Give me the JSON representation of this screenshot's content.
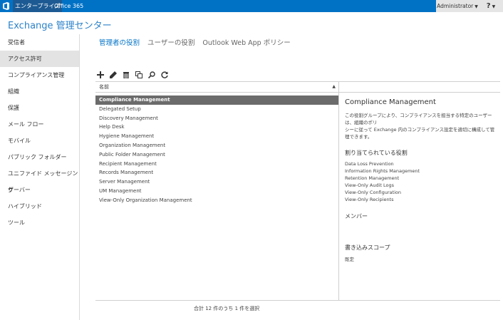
{
  "topbar": {
    "nav_enterprise": "エンタープライズ",
    "nav_office365": "Office 365",
    "admin_label": "Administrator",
    "help_label": "?",
    "accent_color": "#0072c6"
  },
  "app_title": "Exchange 管理センター",
  "sidebar": {
    "items": [
      {
        "label": "受信者"
      },
      {
        "label": "アクセス許可"
      },
      {
        "label": "コンプライアンス管理"
      },
      {
        "label": "組織"
      },
      {
        "label": "保護"
      },
      {
        "label": "メール フロー"
      },
      {
        "label": "モバイル"
      },
      {
        "label": "パブリック フォルダー"
      },
      {
        "label": "ユニファイド メッセージング"
      },
      {
        "label": "サーバー"
      },
      {
        "label": "ハイブリッド"
      },
      {
        "label": "ツール"
      }
    ],
    "active_index": 1
  },
  "tabs": [
    {
      "label": "管理者の役割"
    },
    {
      "label": "ユーザーの役割"
    },
    {
      "label": "Outlook Web App ポリシー"
    }
  ],
  "toolbar": {
    "icons": [
      "add-icon",
      "edit-icon",
      "delete-icon",
      "copy-icon",
      "search-icon",
      "refresh-icon"
    ]
  },
  "list": {
    "column_header": "名前",
    "rows": [
      "Compliance Management",
      "Delegated Setup",
      "Discovery Management",
      "Help Desk",
      "Hygiene Management",
      "Organization Management",
      "Public Folder Management",
      "Recipient Management",
      "Records Management",
      "Server Management",
      "UM Management",
      "View-Only Organization Management"
    ],
    "selected_index": 0
  },
  "status": "合計 12 件のうち 1 件を選択",
  "details": {
    "title": "Compliance Management",
    "description_line1": "この役割グループにより、コンプライアンスを担当する特定のユーザーは、組織のポリ",
    "description_line2": "シーに従って Exchange 内のコンプライアンス設定を適切に構成して管理できます。",
    "roles_heading": "割り当てられている役割",
    "roles": [
      "Data Loss Prevention",
      "Information Rights Management",
      "Retention Management",
      "View-Only Audit Logs",
      "View-Only Configuration",
      "View-Only Recipients"
    ],
    "members_heading": "メンバー",
    "write_scope_heading": "書き込みスコープ",
    "write_scope_value": "既定"
  }
}
